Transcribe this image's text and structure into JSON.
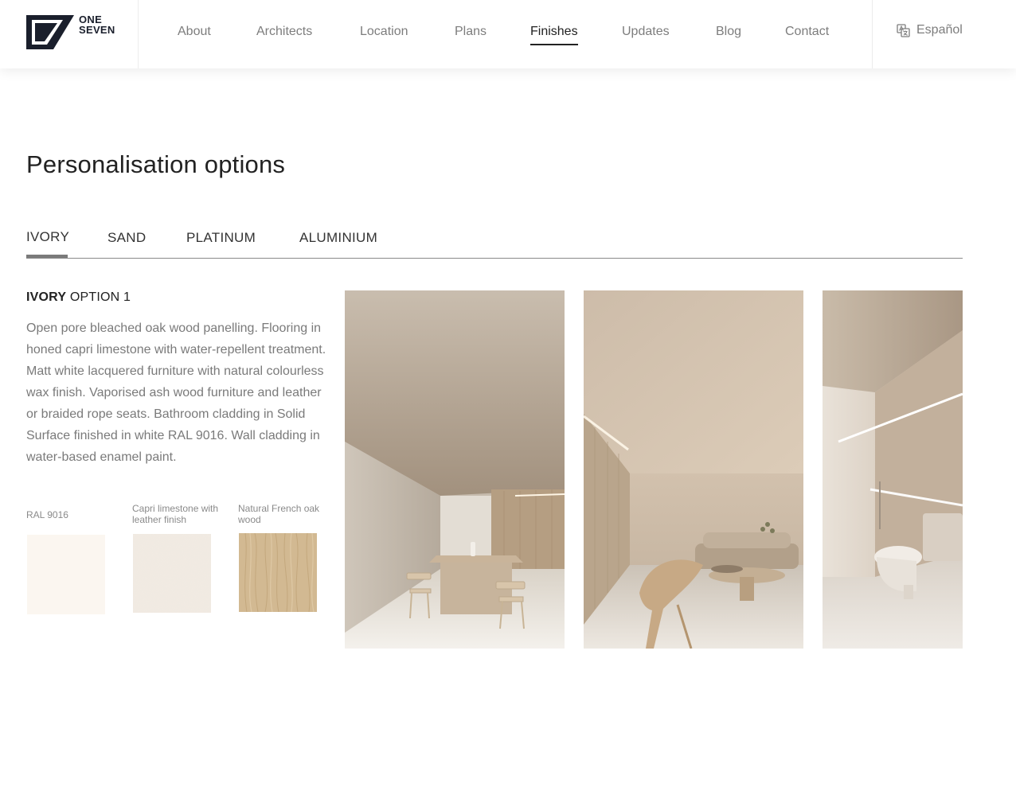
{
  "header": {
    "logo_line1": "ONE",
    "logo_line2": "SEVEN",
    "nav": [
      "About",
      "Architects",
      "Location",
      "Plans",
      "Finishes",
      "Updates",
      "Blog",
      "Contact"
    ],
    "active_nav": "Finishes",
    "language": "Español",
    "language_icon": "translate-icon"
  },
  "page": {
    "title": "Personalisation options"
  },
  "tabs": [
    "IVORY",
    "SAND",
    "PLATINUM",
    "ALUMINIUM"
  ],
  "active_tab": "IVORY",
  "option": {
    "heading_bold": "IVORY",
    "heading_rest": " OPTION 1",
    "description": "Open pore bleached oak wood panelling. Flooring in honed capri limestone with water-repellent treatment. Matt white lacquered furniture with natural colourless wax finish. Vaporised ash wood furniture and leather or braided rope seats. Bathroom cladding in Solid Surface finished in white RAL 9016. Wall cladding in water-based enamel paint."
  },
  "swatches": [
    {
      "label": "RAL 9016",
      "color": "#fbf6f0"
    },
    {
      "label": "Capri limestone with leather finish",
      "color": "#f1ebe3"
    },
    {
      "label": "Natural French oak wood",
      "color": "#d2b992"
    }
  ],
  "photos": [
    "dining-room-render",
    "living-room-render",
    "bathroom-render"
  ],
  "colors": {
    "accent_dark": "#1a1f2c",
    "nav_text": "#7d7d7d",
    "body_text": "#7a7a7a"
  }
}
